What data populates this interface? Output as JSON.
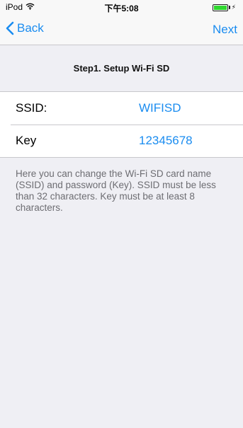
{
  "status_bar": {
    "carrier": "iPod",
    "time": "下午5:08",
    "battery_level": 1.0
  },
  "nav": {
    "back_label": "Back",
    "next_label": "Next"
  },
  "section_title": "Step1. Setup Wi-Fi SD",
  "fields": [
    {
      "label": "SSID:",
      "value": "WIFISD"
    },
    {
      "label": "Key",
      "value": "12345678"
    }
  ],
  "footer_text": "Here you can change the Wi-Fi SD card name (SSID) and password (Key). SSID must be less than 32 characters. Key must be at least 8 characters.",
  "colors": {
    "accent": "#1a8cf0",
    "background": "#efeff4",
    "battery": "#2fd82f"
  },
  "icons": {
    "wifi": "wifi-icon",
    "back": "chevron-left-icon",
    "battery": "battery-icon",
    "charging": "charging-bolt-icon"
  }
}
